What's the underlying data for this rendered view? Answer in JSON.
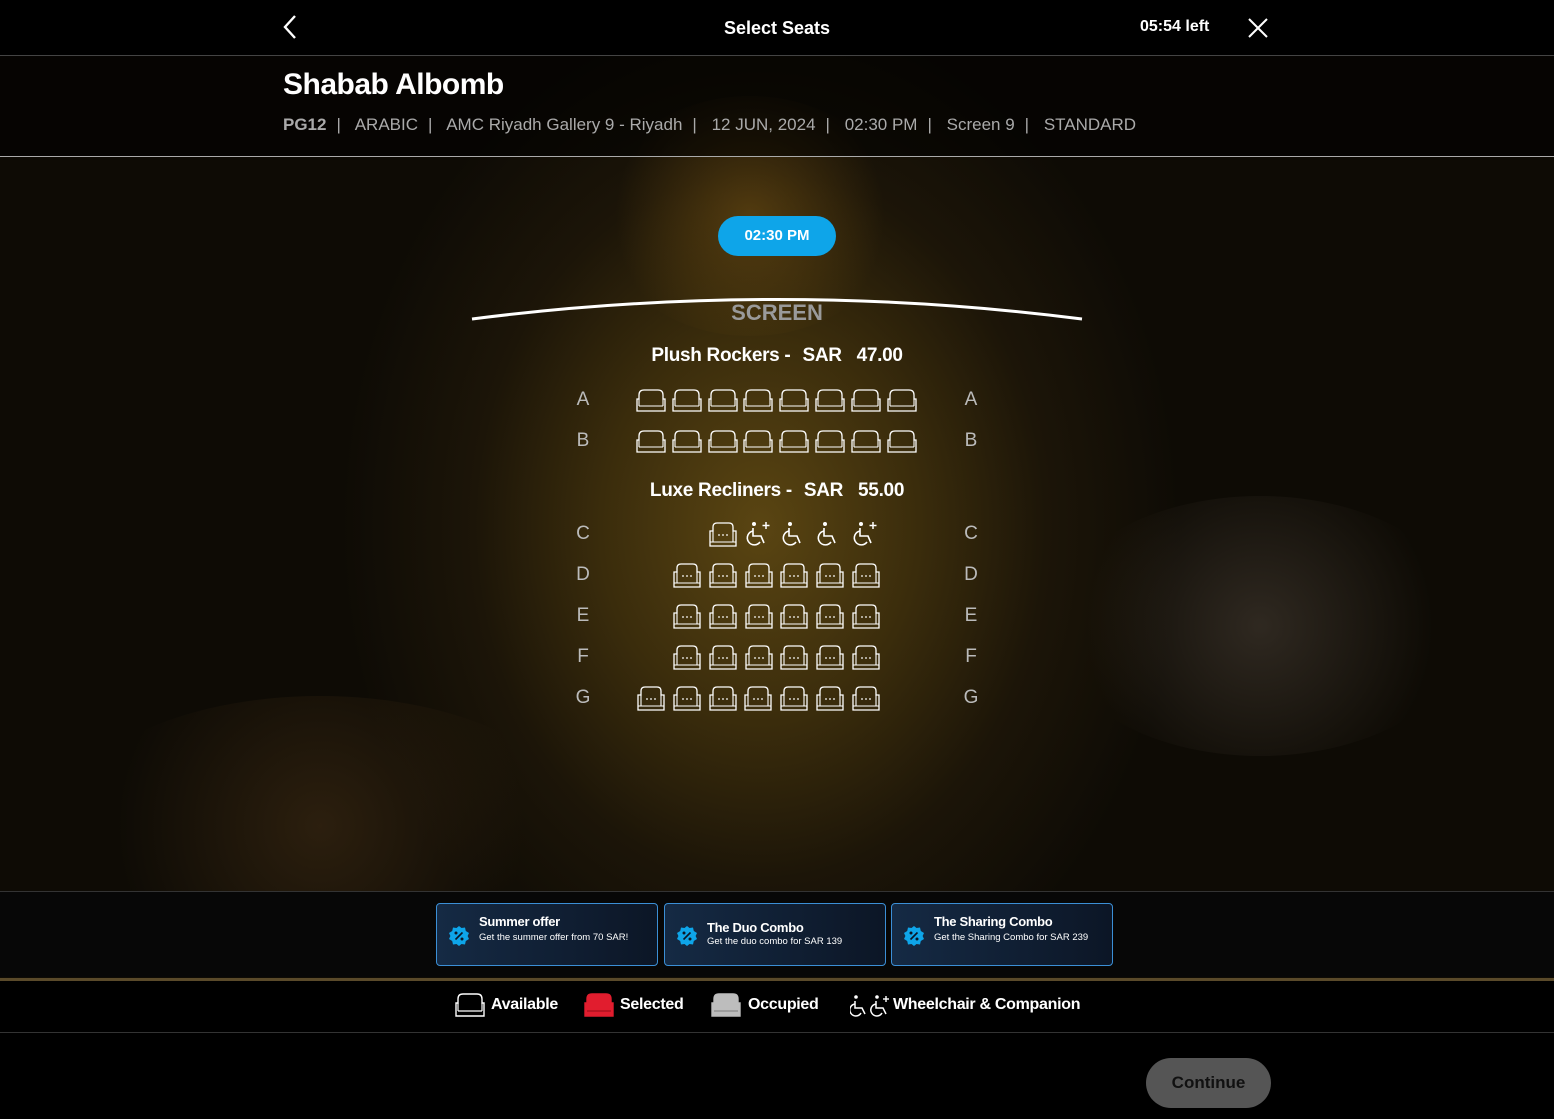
{
  "header": {
    "title": "Select Seats",
    "timer": "05:54 left",
    "back_icon": "chevron-left-icon",
    "close_icon": "close-icon"
  },
  "movie": {
    "title": "Shabab Albomb",
    "meta": [
      "PG12",
      "ARABIC",
      "AMC Riyadh Gallery 9 - Riyadh",
      "12 JUN, 2024",
      "02:30 PM",
      "Screen 9",
      "STANDARD"
    ]
  },
  "showtime": {
    "selected": "02:30 PM"
  },
  "screen_label": "SCREEN",
  "sections": [
    {
      "name": "Plush Rockers -",
      "price": "SAR   47.00",
      "rows": [
        {
          "label": "A",
          "seats": [
            "available",
            "available",
            "available",
            "available",
            "available",
            "available",
            "available",
            "available"
          ]
        },
        {
          "label": "B",
          "seats": [
            "available",
            "available",
            "available",
            "available",
            "available",
            "available",
            "available",
            "available"
          ]
        }
      ]
    },
    {
      "name": "Luxe Recliners -",
      "price": "SAR   55.00",
      "rows": [
        {
          "label": "C",
          "seats": [
            "available",
            "companion",
            "wheelchair",
            "wheelchair",
            "companion"
          ]
        },
        {
          "label": "D",
          "seats": [
            "available",
            "available",
            "available",
            "available",
            "available",
            "available"
          ]
        },
        {
          "label": "E",
          "seats": [
            "available",
            "available",
            "available",
            "available",
            "available",
            "available"
          ]
        },
        {
          "label": "F",
          "seats": [
            "available",
            "available",
            "available",
            "available",
            "available",
            "available"
          ]
        },
        {
          "label": "G",
          "seats": [
            "available",
            "available",
            "available",
            "available",
            "available",
            "available",
            "available"
          ]
        }
      ]
    }
  ],
  "offers": [
    {
      "title": "Summer offer",
      "desc": "Get the summer offer from 70 SAR!",
      "icon": "discount-badge-icon"
    },
    {
      "title": "The Duo Combo",
      "desc": "Get the duo combo for SAR 139",
      "icon": "discount-badge-icon"
    },
    {
      "title": "The Sharing Combo",
      "desc": "Get the Sharing Combo for SAR 239",
      "icon": "discount-badge-icon"
    }
  ],
  "legend": {
    "available": "Available",
    "selected": "Selected",
    "occupied": "Occupied",
    "wheelchair": "Wheelchair & Companion"
  },
  "colors": {
    "accent": "#0ea5e9",
    "selected": "#e11d2e",
    "occupied": "#bdbdbd",
    "offer_border": "#3b8fd6",
    "continue_bg": "#555555"
  },
  "continue_label": "Continue"
}
